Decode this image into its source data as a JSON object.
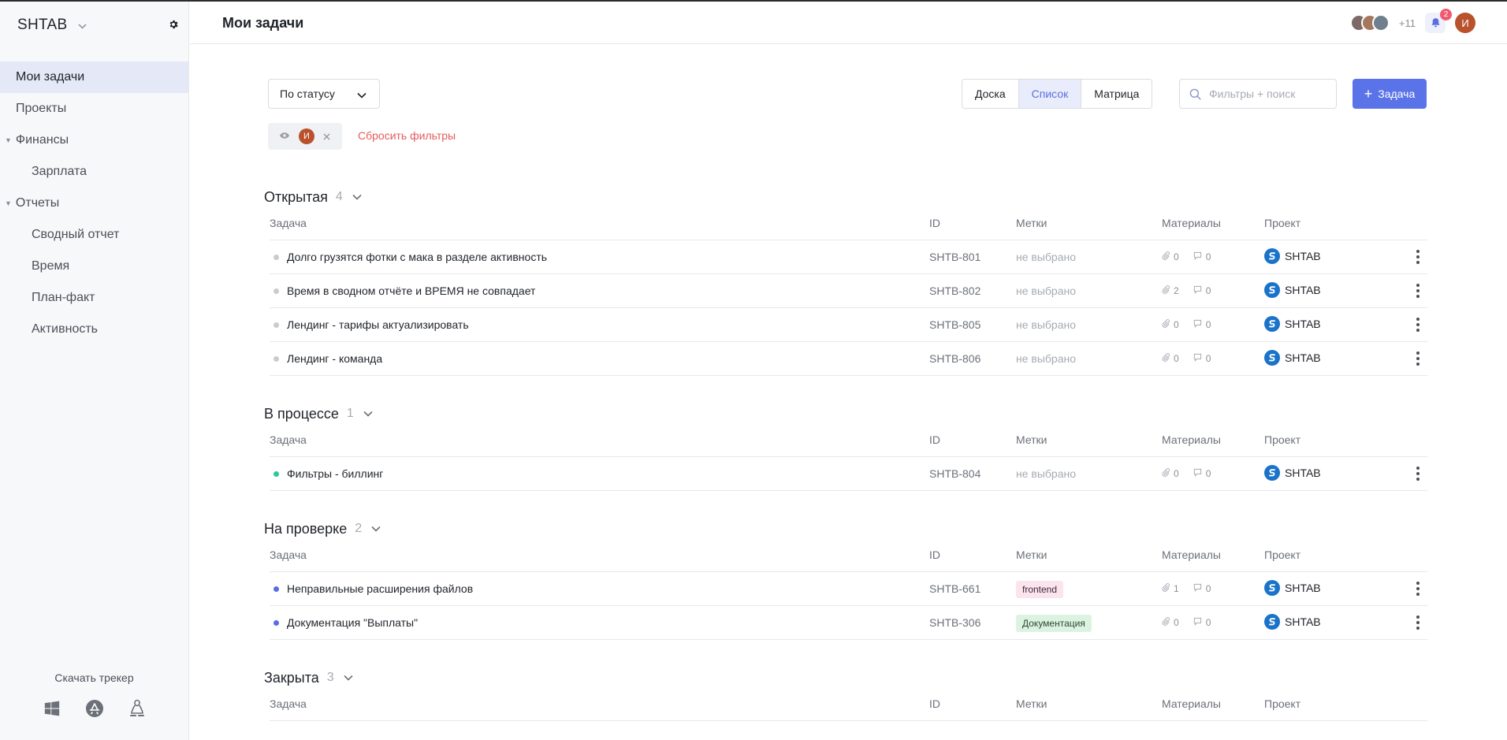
{
  "sidebar": {
    "brand": "SHTAB",
    "nav": [
      {
        "label": "Мои задачи",
        "kind": "item",
        "active": true
      },
      {
        "label": "Проекты",
        "kind": "item"
      },
      {
        "label": "Финансы",
        "kind": "group"
      },
      {
        "label": "Зарплата",
        "kind": "sub"
      },
      {
        "label": "Отчеты",
        "kind": "group"
      },
      {
        "label": "Сводный отчет",
        "kind": "sub"
      },
      {
        "label": "Время",
        "kind": "sub"
      },
      {
        "label": "План-факт",
        "kind": "sub"
      },
      {
        "label": "Активность",
        "kind": "sub"
      }
    ],
    "download_label": "Скачать трекер",
    "platforms": [
      "windows-icon",
      "app-store-icon",
      "linux-icon"
    ]
  },
  "header": {
    "title": "Мои задачи",
    "team_more": "+11",
    "notifications": "2",
    "user_initial": "И"
  },
  "toolbar": {
    "group_by": "По статусу",
    "views": [
      {
        "label": "Доска",
        "active": false
      },
      {
        "label": "Список",
        "active": true
      },
      {
        "label": "Матрица",
        "active": false
      }
    ],
    "search_placeholder": "Фильтры + поиск",
    "add_task_label": "Задача",
    "filter_chip_initial": "И",
    "reset_filters": "Сбросить фильтры"
  },
  "columns": {
    "task": "Задача",
    "id": "ID",
    "tags": "Метки",
    "materials": "Материалы",
    "project": "Проект"
  },
  "sections": [
    {
      "title": "Открытая",
      "count": "4",
      "dot_color": "#c8cbd0",
      "rows": [
        {
          "title": "Долго грузятся фотки с мака в разделе активность",
          "id": "SHTB-801",
          "tag": null,
          "files": "0",
          "comments": "0",
          "project": "SHTAB"
        },
        {
          "title": "Время в сводном отчёте и ВРЕМЯ не совпадает",
          "id": "SHTB-802",
          "tag": null,
          "files": "2",
          "comments": "0",
          "project": "SHTAB"
        },
        {
          "title": "Лендинг - тарифы актуализировать",
          "id": "SHTB-805",
          "tag": null,
          "files": "0",
          "comments": "0",
          "project": "SHTAB"
        },
        {
          "title": "Лендинг - команда",
          "id": "SHTB-806",
          "tag": null,
          "files": "0",
          "comments": "0",
          "project": "SHTAB"
        }
      ]
    },
    {
      "title": "В процессе",
      "count": "1",
      "dot_color": "#2ec79b",
      "rows": [
        {
          "title": "Фильтры - биллинг",
          "id": "SHTB-804",
          "tag": null,
          "files": "0",
          "comments": "0",
          "project": "SHTAB"
        }
      ]
    },
    {
      "title": "На проверке",
      "count": "2",
      "dot_color": "#5b6ee1",
      "rows": [
        {
          "title": "Неправильные расширения файлов",
          "id": "SHTB-661",
          "tag": {
            "label": "frontend",
            "bg": "#fbe4ee",
            "fg": "#3a2a33"
          },
          "files": "1",
          "comments": "0",
          "project": "SHTAB"
        },
        {
          "title": "Документация \"Выплаты\"",
          "id": "SHTB-306",
          "tag": {
            "label": "Документация",
            "bg": "#dcf3e2",
            "fg": "#2b4a33"
          },
          "files": "0",
          "comments": "0",
          "project": "SHTAB"
        }
      ]
    },
    {
      "title": "Закрыта",
      "count": "3",
      "dot_color": "#c8cbd0",
      "rows": []
    }
  ],
  "empty_tag_label": "не выбрано",
  "colors": {
    "accent": "#5b73e8",
    "danger": "#e85a5a",
    "project_logo": "#1a73c9"
  }
}
